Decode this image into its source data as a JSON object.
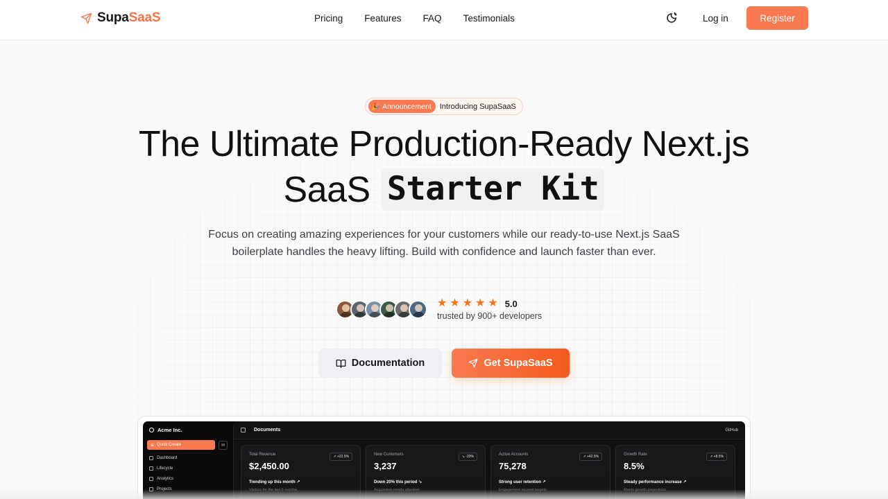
{
  "nav": {
    "logo_part1": "Supa",
    "logo_part2": "SaaS",
    "links": [
      "Pricing",
      "Features",
      "FAQ",
      "Testimonials"
    ],
    "login": "Log in",
    "register": "Register",
    "theme_icon": "theme-toggle-icon"
  },
  "hero": {
    "badge_pill": "Announcement",
    "badge_emoji": "🎉",
    "badge_text": "Introducing SupaSaaS",
    "title_line1": "The Ultimate Production-Ready Next.js",
    "title_line2_plain": "SaaS",
    "title_line2_mono": "Starter Kit",
    "subtitle": "Focus on creating amazing experiences for your customers while our ready-to-use Next.js SaaS boilerplate handles the heavy lifting. Build with confidence and launch faster than ever.",
    "rating": "5.0",
    "stars": 5,
    "trusted": "trusted by 900+ developers",
    "avatar_colors": [
      "#8a5a3c",
      "#5b6470",
      "#7d8fa3",
      "#3e5a4a",
      "#6b6b6b",
      "#4a6785"
    ],
    "doc_button": "Documentation",
    "cta_button": "Get SupaSaaS"
  },
  "dashboard": {
    "org": "Acme Inc.",
    "quick_create": "Quick Create",
    "sidebar": [
      "Dashboard",
      "Lifecycle",
      "Analytics",
      "Projects"
    ],
    "page_title": "Documents",
    "github": "GitHub",
    "cards": [
      {
        "label": "Total Revenue",
        "delta": "↗ +22.5%",
        "value": "$2,450.00",
        "trend": "Trending up this month ↗",
        "note": "Visitors for the last 6 months"
      },
      {
        "label": "New Customers",
        "delta": "↘ -20%",
        "value": "3,237",
        "trend": "Down 20% this period ↘",
        "note": "Acquisition needs attention"
      },
      {
        "label": "Active Accounts",
        "delta": "↗ +42.5%",
        "value": "75,278",
        "trend": "Strong user retention ↗",
        "note": "Engagement exceed targets"
      },
      {
        "label": "Growth Rate",
        "delta": "↗ +8.5%",
        "value": "8.5%",
        "trend": "Steady performance increase ↗",
        "note": "Meets growth projections"
      }
    ]
  },
  "colors": {
    "brand": "#f97a50",
    "brand_dark": "#f45a1e",
    "star": "#f97316",
    "dashboard_bg": "#0a0a0a"
  }
}
